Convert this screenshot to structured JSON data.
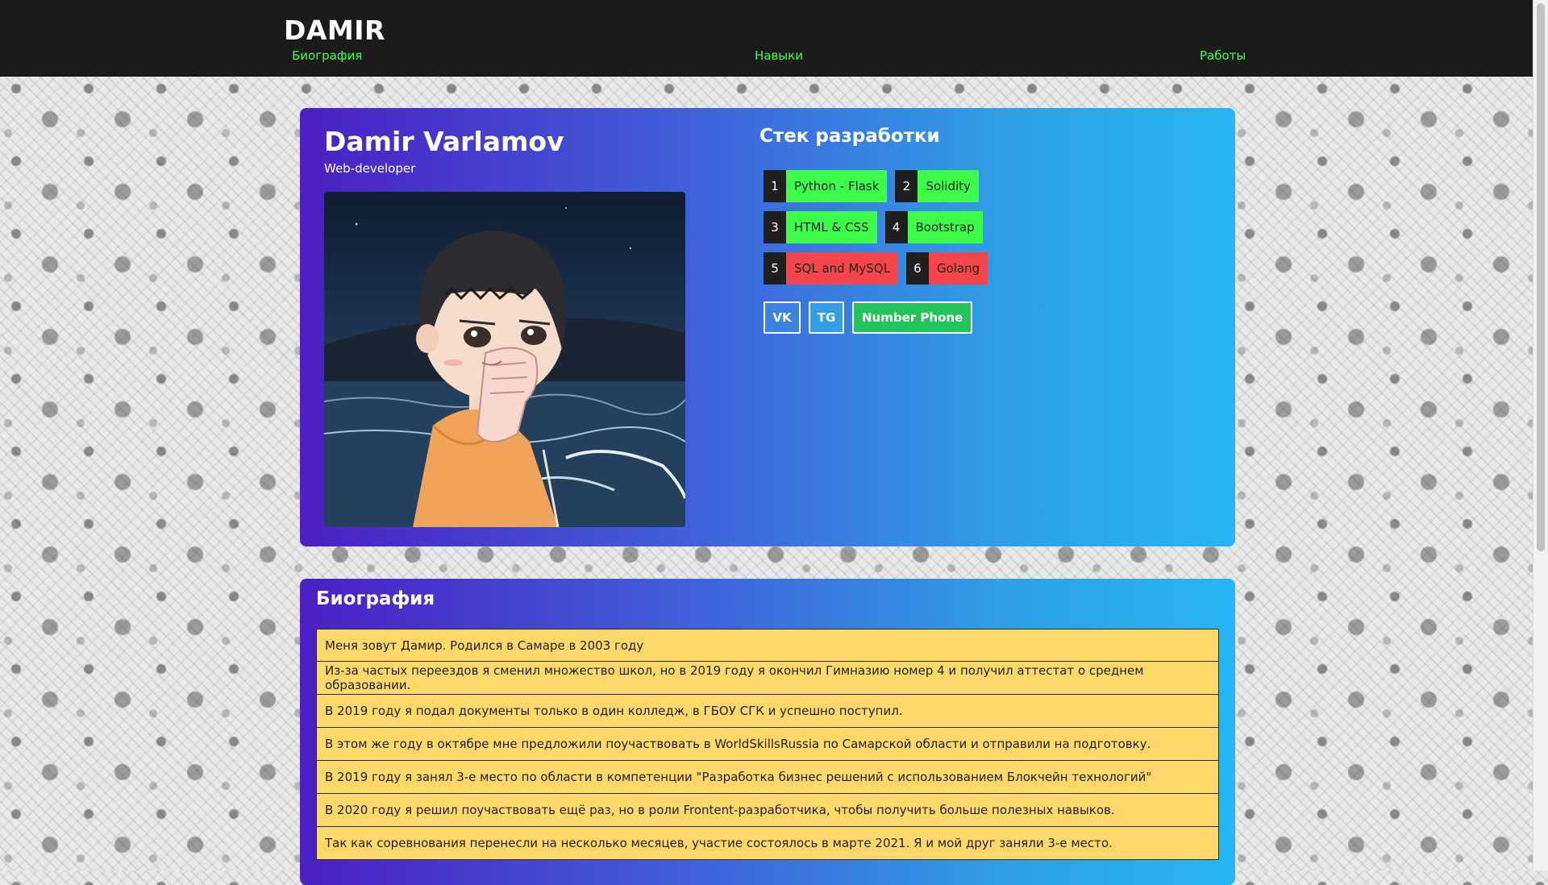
{
  "navbar": {
    "brand": "DAMIR",
    "links": [
      "Биография",
      "Навыки",
      "Работы"
    ],
    "link_color": "#3bff4a"
  },
  "hero": {
    "name": "Damir Varlamov",
    "subtitle": "Web-developer",
    "stack_title": "Стек разработки",
    "skills": [
      {
        "num": "1",
        "name": "Python - Flask",
        "color": "#3dfc4a"
      },
      {
        "num": "2",
        "name": "Solidity",
        "color": "#3dfc4a"
      },
      {
        "num": "3",
        "name": "HTML & CSS",
        "color": "#3dfc4a"
      },
      {
        "num": "4",
        "name": "Bootstrap",
        "color": "#3dfc4a"
      },
      {
        "num": "5",
        "name": "SQL and MySQL",
        "color": "#f4454a"
      },
      {
        "num": "6",
        "name": "Golang",
        "color": "#f4454a"
      }
    ],
    "social": {
      "vk": "VK",
      "tg": "TG",
      "phone": "Number Phone"
    }
  },
  "bio": {
    "title": "Биография",
    "items": [
      "Меня зовут Дамир. Родился в Самаре в 2003 году",
      "Из-за частых переездов я сменил множество школ, но в 2019 году я окончил Гимназию номер 4 и получил аттестат о среднем образовании.",
      "В 2019 году я подал документы только в один колледж, в ГБОУ СГК и успешно поступил.",
      "В этом же году в октябре мне предложили поучаствовать в WorldSkillsRussia по Самарской области и отправили на подготовку.",
      "В 2019 году я занял 3-е место по области в компетенции \"Разработка бизнес решений с использованием Блокчейн технологий\"",
      "В 2020 году я решил поучаствовать ещё раз, но в роли Frontent-разработчика, чтобы получить больше полезных навыков.",
      "Так как соревнования перенесли на несколько месяцев, участие состоялось в марте 2021. Я и мой друг заняли 3-е место."
    ]
  },
  "colors": {
    "navbar_bg": "#1b1b1b",
    "card_gradient_start": "#4b1fc4",
    "card_gradient_end": "#26b6f4",
    "bio_item_bg": "#ffd86b",
    "phone_button": "#21c45a"
  }
}
